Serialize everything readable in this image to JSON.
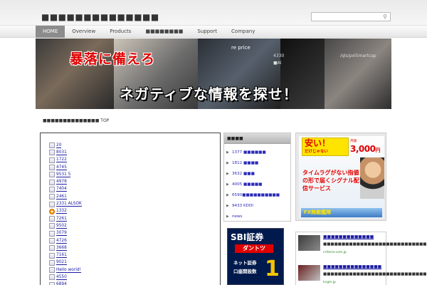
{
  "header": {
    "site_title": "■■■■■■■■■■■■■■"
  },
  "nav": {
    "items": [
      {
        "label": "HOME",
        "active": true
      },
      {
        "label": "Overview",
        "active": false
      },
      {
        "label": "Products",
        "active": false
      },
      {
        "label": "■■■■■■■■",
        "active": false
      },
      {
        "label": "Support",
        "active": false
      },
      {
        "label": "Company",
        "active": false
      }
    ]
  },
  "banner": {
    "headline_red": "暴落に備えろ",
    "headline_white": "ネガティブな情報を探せ！",
    "ticker_line_1": "re price",
    "ticker_line_2": "4330",
    "ticker_line_3": "/qls/pxlSmartcap",
    "ticker_line_4": "■AI"
  },
  "breadcrumb": "■■■■■■■■■■■■■■ TOP",
  "posts": [
    {
      "label": "20",
      "icon": "page-icon"
    },
    {
      "label": "8031",
      "icon": "page-icon"
    },
    {
      "label": "1722",
      "icon": "page-icon"
    },
    {
      "label": "4745",
      "icon": "page-icon"
    },
    {
      "label": "9531        5",
      "icon": "page-icon"
    },
    {
      "label": "4978",
      "icon": "page-icon"
    },
    {
      "label": "7404",
      "icon": "page-icon"
    },
    {
      "label": "2461",
      "icon": "page-icon"
    },
    {
      "label": "2331       ALSOK",
      "icon": "page-icon"
    },
    {
      "label": "1332",
      "icon": "safari-icon"
    },
    {
      "label": "7261",
      "icon": "page-icon"
    },
    {
      "label": "9502",
      "icon": "page-icon"
    },
    {
      "label": "3079",
      "icon": "page-icon"
    },
    {
      "label": "4726",
      "icon": "page-icon"
    },
    {
      "label": "3668",
      "icon": "page-icon"
    },
    {
      "label": "7161",
      "icon": "page-icon"
    },
    {
      "label": "9021",
      "icon": "page-icon"
    },
    {
      "label": "Hello world!",
      "icon": "page-icon"
    },
    {
      "label": "4550",
      "icon": "page-icon"
    },
    {
      "label": "6894",
      "icon": "page-icon"
    }
  ],
  "categories": {
    "header": "■■■■",
    "items": [
      "1377 ■■■■■■",
      "1812 ■■■■",
      "3632 ■■■",
      "4005 ■■■■■",
      "6590■■■■■■■■■■",
      "9433 KDDI",
      "news"
    ]
  },
  "ad_fx": {
    "yasui": "安い！",
    "sub": "だけじゃない",
    "month_label": "月額",
    "price": "3,000",
    "price_suffix": "円",
    "tagline": "タイムラグがない指値の形で届くシグナル配信サービス",
    "brand": "FX無敵艦隊"
  },
  "ad_sbi": {
    "logo": "SBI証券",
    "badge": "ダントツ",
    "line1": "ネット証券",
    "line2": "口座開設数",
    "rank": "1"
  },
  "related_links": [
    {
      "title": "■■■■■■■■■■■■■",
      "desc": "■■■■■■■■■■■■■■■■■■■■■■■■■■■■■■■■",
      "url": "criteria-com.jp"
    },
    {
      "title": "■■■■■■■■■■■■■■■",
      "desc": "■■■■■■■■■■■■■■■■■■■■■■■■■■■■■■■",
      "url": "kcgm.jp"
    }
  ],
  "colors": {
    "nav_active": "#8c8c8c",
    "link": "#1a1aa0",
    "headline_red": "#e10000",
    "ad_yellow": "#ffe400",
    "sbi_navy": "#001a4d"
  }
}
